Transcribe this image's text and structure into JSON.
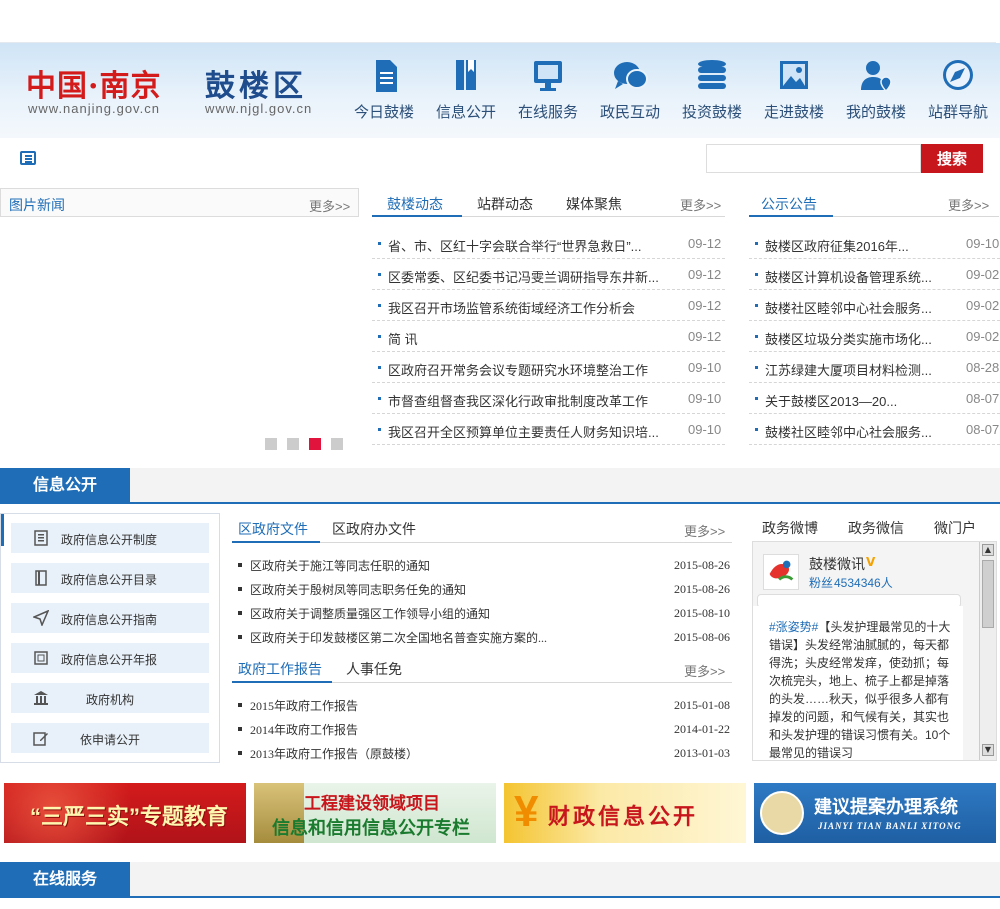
{
  "header": {
    "logo_cn": "中国·南京",
    "logo_url1": "www.nanjing.gov.cn",
    "logo_gl": "鼓楼区",
    "logo_url2": "www.njgl.gov.cn",
    "nav": [
      {
        "label": "今日鼓楼",
        "icon": "document-icon"
      },
      {
        "label": "信息公开",
        "icon": "book-icon"
      },
      {
        "label": "在线服务",
        "icon": "monitor-icon"
      },
      {
        "label": "政民互动",
        "icon": "chat-icon"
      },
      {
        "label": "投资鼓楼",
        "icon": "coins-icon"
      },
      {
        "label": "走进鼓楼",
        "icon": "picture-icon"
      },
      {
        "label": "我的鼓楼",
        "icon": "user-location-icon"
      },
      {
        "label": "站群导航",
        "icon": "compass-icon"
      }
    ]
  },
  "search": {
    "placeholder": "",
    "button": "搜索"
  },
  "photo_news": {
    "title": "图片新闻",
    "more": "更多>>"
  },
  "news": {
    "tabs": [
      "鼓楼动态",
      "站群动态",
      "媒体聚焦"
    ],
    "more": "更多>>",
    "items": [
      {
        "title": "省、市、区红十字会联合举行“世界急救日”...",
        "date": "09-12"
      },
      {
        "title": "区委常委、区纪委书记冯雯兰调研指导东井新...",
        "date": "09-12"
      },
      {
        "title": "我区召开市场监管系统街域经济工作分析会",
        "date": "09-12"
      },
      {
        "title": "简 讯",
        "date": "09-12"
      },
      {
        "title": "区政府召开常务会议专题研究水环境整治工作",
        "date": "09-10"
      },
      {
        "title": "市督查组督查我区深化行政审批制度改革工作",
        "date": "09-10"
      },
      {
        "title": "我区召开全区预算单位主要责任人财务知识培...",
        "date": "09-10"
      }
    ]
  },
  "notice": {
    "title": "公示公告",
    "more": "更多>>",
    "items": [
      {
        "title": "鼓楼区政府征集2016年...",
        "date": "09-10"
      },
      {
        "title": "鼓楼区计算机设备管理系统...",
        "date": "09-02"
      },
      {
        "title": "鼓楼社区睦邻中心社会服务...",
        "date": "09-02"
      },
      {
        "title": "鼓楼区垃圾分类实施市场化...",
        "date": "09-02"
      },
      {
        "title": "江苏绿建大厦项目材料检测...",
        "date": "08-28"
      },
      {
        "title": "关于鼓楼区2013—20...",
        "date": "08-07"
      },
      {
        "title": "鼓楼社区睦邻中心社会服务...",
        "date": "08-07"
      }
    ]
  },
  "info_open": {
    "section_title": "信息公开",
    "side": [
      {
        "label": "政府信息公开制度",
        "icon": "doc-list-icon"
      },
      {
        "label": "政府信息公开目录",
        "icon": "book-icon"
      },
      {
        "label": "政府信息公开指南",
        "icon": "paper-plane-icon"
      },
      {
        "label": "政府信息公开年报",
        "icon": "report-icon"
      },
      {
        "label": "政府机构",
        "icon": "building-icon"
      },
      {
        "label": "依申请公开",
        "icon": "edit-icon"
      }
    ],
    "docs_tabs": [
      "区政府文件",
      "区政府办文件"
    ],
    "docs_more": "更多>>",
    "docs": [
      {
        "title": "区政府关于施江等同志任职的通知",
        "date": "2015-08-26"
      },
      {
        "title": "区政府关于殷树凤等同志职务任免的通知",
        "date": "2015-08-26"
      },
      {
        "title": "区政府关于调整质量强区工作领导小组的通知",
        "date": "2015-08-10"
      },
      {
        "title": "区政府关于印发鼓楼区第二次全国地名普查实施方案的...",
        "date": "2015-08-06"
      }
    ],
    "report_tabs": [
      "政府工作报告",
      "人事任免"
    ],
    "report_more": "更多>>",
    "reports": [
      {
        "title": "2015年政府工作报告",
        "date": "2015-01-08"
      },
      {
        "title": "2014年政府工作报告",
        "date": "2014-01-22"
      },
      {
        "title": "2013年政府工作报告（原鼓楼）",
        "date": "2013-01-03"
      }
    ]
  },
  "weibo": {
    "tabs": [
      "政务微博",
      "政务微信",
      "微门户"
    ],
    "account": "鼓楼微讯",
    "fans_label": "粉丝",
    "fans": "4534346人",
    "post_tag": "#涨姿势#",
    "post": "【头发护理最常见的十大错误】头发经常油腻腻的，每天都得洗；头皮经常发痒，使劲抓；每次梳完头，地上、梳子上都是掉落的头发……秋天，似乎很多人都有掉发的问题，和气候有关，其实也和头发护理的错误习惯有关。10个最常见的错误习"
  },
  "banners": [
    {
      "text": "“三严三实”专题教育",
      "bg": "#c8161d"
    },
    {
      "text_line1": "工程建设领域项目",
      "text_line2": "信息和信用信息公开专栏"
    },
    {
      "text": "财政信息公开"
    },
    {
      "text": "建议提案办理系统",
      "sub": "JIANYI TIAN BANLI XITONG"
    }
  ],
  "online_service": {
    "section_title": "在线服务"
  },
  "colors": {
    "accent": "#1f6db6",
    "search_button": "#c8161d",
    "slide_dot_active": "#e0143c"
  }
}
